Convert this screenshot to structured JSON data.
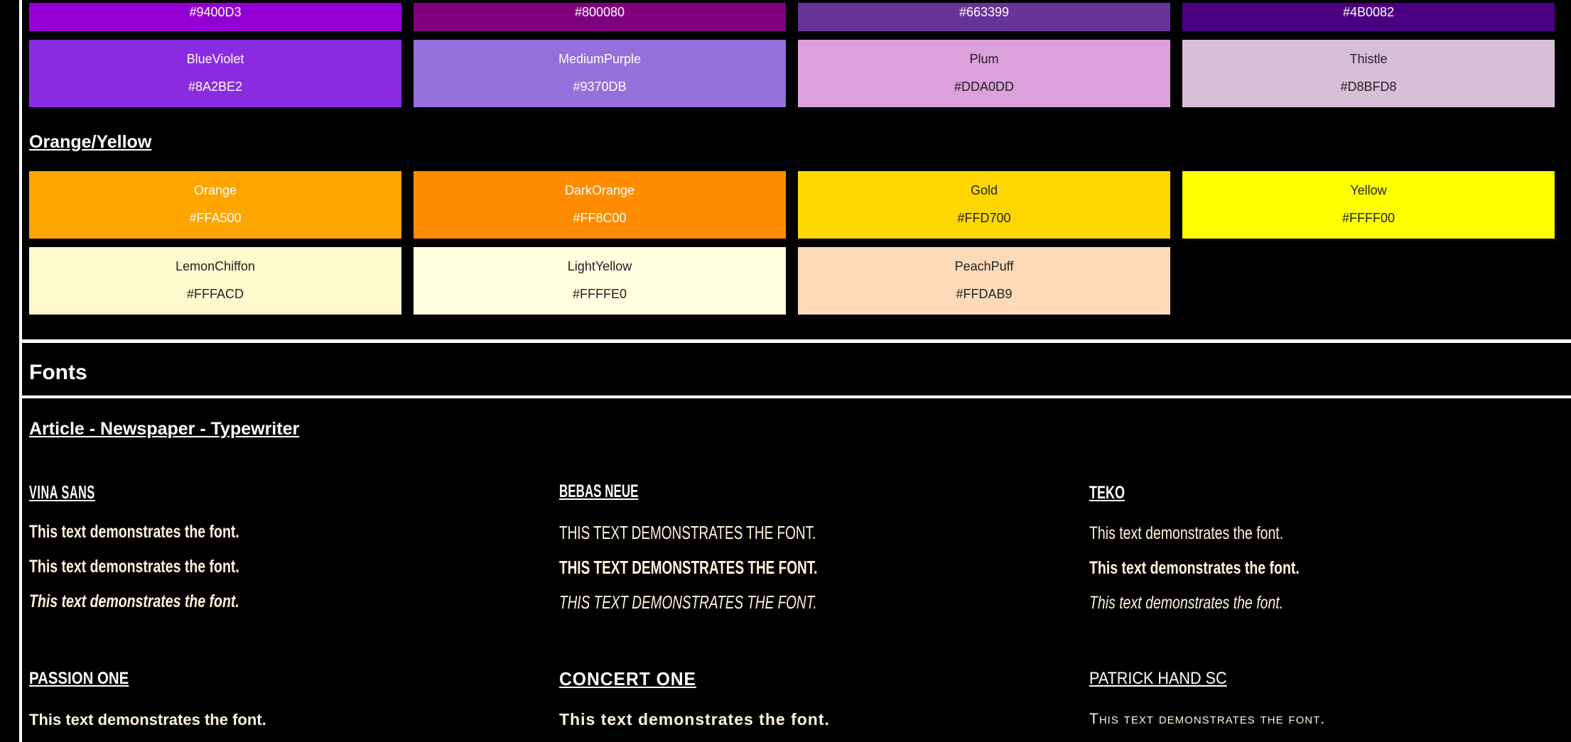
{
  "swatches": {
    "purple_top": [
      {
        "hex": "#9400D3",
        "color": "#9400D3",
        "text_color": "#ffffff"
      },
      {
        "hex": "#800080",
        "color": "#800080",
        "text_color": "#ffffff"
      },
      {
        "hex": "#663399",
        "color": "#663399",
        "text_color": "#ffffff"
      },
      {
        "hex": "#4B0082",
        "color": "#4B0082",
        "text_color": "#ffffff"
      }
    ],
    "purple_bottom": [
      {
        "name": "BlueViolet",
        "hex": "#8A2BE2",
        "color": "#8A2BE2",
        "text_color": "#ffffff"
      },
      {
        "name": "MediumPurple",
        "hex": "#9370DB",
        "color": "#9370DB",
        "text_color": "#ffffff"
      },
      {
        "name": "Plum",
        "hex": "#DDA0DD",
        "color": "#DDA0DD",
        "text_color": "#222222"
      },
      {
        "name": "Thistle",
        "hex": "#D8BFD8",
        "color": "#D8BFD8",
        "text_color": "#222222"
      }
    ],
    "orange_heading": "Orange/Yellow",
    "orange_top": [
      {
        "name": "Orange",
        "hex": "#FFA500",
        "color": "#FFA500",
        "text_color": "#ffffff"
      },
      {
        "name": "DarkOrange",
        "hex": "#FF8C00",
        "color": "#FF8C00",
        "text_color": "#ffffff"
      },
      {
        "name": "Gold",
        "hex": "#FFD700",
        "color": "#FFD700",
        "text_color": "#222222"
      },
      {
        "name": "Yellow",
        "hex": "#FFFF00",
        "color": "#FFFF00",
        "text_color": "#222222"
      }
    ],
    "orange_bottom": [
      {
        "name": "LemonChiffon",
        "hex": "#FFFACD",
        "color": "#FFFACD",
        "text_color": "#222222"
      },
      {
        "name": "LightYellow",
        "hex": "#FFFFE0",
        "color": "#FFFFE0",
        "text_color": "#222222"
      },
      {
        "name": "PeachPuff",
        "hex": "#FFDAB9",
        "color": "#FFDAB9",
        "text_color": "#222222"
      }
    ]
  },
  "fonts": {
    "title": "Fonts",
    "category_heading": "Article - Newspaper - Typewriter",
    "sample_text": "This text demonstrates the font.",
    "row1": [
      {
        "name": "Vina Sans"
      },
      {
        "name": "Bebas Neue"
      },
      {
        "name": "Teko"
      }
    ],
    "row2": [
      {
        "name": "Passion One"
      },
      {
        "name": "Concert One"
      },
      {
        "name": "Patrick Hand SC"
      }
    ]
  },
  "colors": {
    "background": "#000000",
    "rule": "#ffffff",
    "sample_text": "#fff5dc"
  }
}
